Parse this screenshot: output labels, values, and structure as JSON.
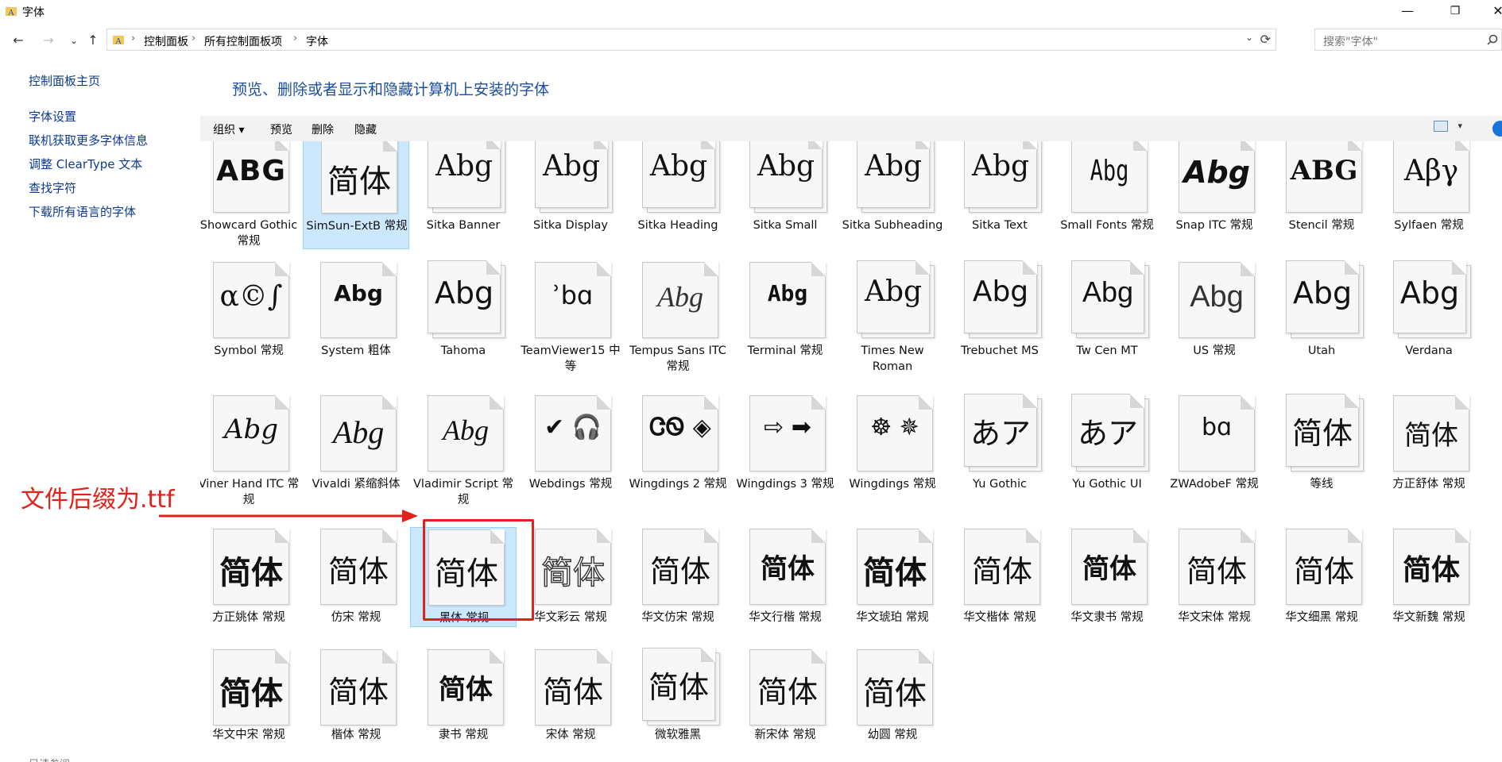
{
  "window": {
    "title": "字体",
    "minimize": "—",
    "restore": "❐",
    "close": "✕"
  },
  "nav": {
    "back": "←",
    "forward": "→",
    "dropdown": "⌄",
    "up": "↑"
  },
  "address": {
    "crumbs": [
      "控制面板",
      "所有控制面板项",
      "字体"
    ],
    "separator": "›",
    "dropdown": "⌄",
    "refresh": "⟳"
  },
  "search": {
    "placeholder": "搜索\"字体\""
  },
  "sidebar": {
    "home": "控制面板主页",
    "links": [
      "字体设置",
      "联机获取更多字体信息",
      "调整 ClearType 文本",
      "查找字符",
      "下载所有语言的字体"
    ],
    "bottom": "另请参阅"
  },
  "heading": "预览、删除或者显示和隐藏计算机上安装的字体",
  "toolbar": {
    "organize": "组织 ▾",
    "preview": "预览",
    "delete": "删除",
    "hide": "隐藏",
    "view_drop": "▾"
  },
  "fonts": [
    {
      "sample": "ABG",
      "label": "Showcard Gothic 常规",
      "stack": false,
      "sel": false
    },
    {
      "sample": "简体",
      "label": "SimSun-ExtB 常规",
      "stack": false,
      "sel": true
    },
    {
      "sample": "Abg",
      "label": "Sitka Banner",
      "stack": true,
      "sel": false
    },
    {
      "sample": "Abg",
      "label": "Sitka Display",
      "stack": true,
      "sel": false
    },
    {
      "sample": "Abg",
      "label": "Sitka Heading",
      "stack": true,
      "sel": false
    },
    {
      "sample": "Abg",
      "label": "Sitka Small",
      "stack": true,
      "sel": false
    },
    {
      "sample": "Abg",
      "label": "Sitka Subheading",
      "stack": true,
      "sel": false
    },
    {
      "sample": "Abg",
      "label": "Sitka Text",
      "stack": true,
      "sel": false
    },
    {
      "sample": "Abg",
      "label": "Small Fonts 常规",
      "stack": false,
      "sel": false
    },
    {
      "sample": "Abg",
      "label": "Snap ITC 常规",
      "stack": false,
      "sel": false
    },
    {
      "sample": "ABG",
      "label": "Stencil 常规",
      "stack": false,
      "sel": false
    },
    {
      "sample": "Αβγ",
      "label": "Sylfaen 常规",
      "stack": false,
      "sel": false
    },
    {
      "sample": "α©∫",
      "label": "Symbol 常规",
      "stack": false,
      "sel": false
    },
    {
      "sample": "Abg",
      "label": "System 粗体",
      "stack": false,
      "sel": false
    },
    {
      "sample": "Abg",
      "label": "Tahoma",
      "stack": true,
      "sel": false
    },
    {
      "sample": "ʾbɑ",
      "label": "TeamViewer15 中等",
      "stack": false,
      "sel": false
    },
    {
      "sample": "Abg",
      "label": "Tempus Sans ITC 常规",
      "stack": false,
      "sel": false
    },
    {
      "sample": "Abg",
      "label": "Terminal 常规",
      "stack": false,
      "sel": false
    },
    {
      "sample": "Abg",
      "label": "Times New Roman",
      "stack": true,
      "sel": false
    },
    {
      "sample": "Abg",
      "label": "Trebuchet MS",
      "stack": true,
      "sel": false
    },
    {
      "sample": "Abg",
      "label": "Tw Cen MT",
      "stack": true,
      "sel": false
    },
    {
      "sample": "Abg",
      "label": "US 常规",
      "stack": false,
      "sel": false
    },
    {
      "sample": "Abg",
      "label": "Utah",
      "stack": true,
      "sel": false
    },
    {
      "sample": "Abg",
      "label": "Verdana",
      "stack": true,
      "sel": false
    },
    {
      "sample": "Abg",
      "label": "Viner Hand ITC 常规",
      "stack": false,
      "sel": false
    },
    {
      "sample": "Abg",
      "label": "Vivaldi 紧缩斜体",
      "stack": false,
      "sel": false
    },
    {
      "sample": "Abg",
      "label": "Vladimir Script 常规",
      "stack": false,
      "sel": false
    },
    {
      "sample": "✔ 🎧",
      "label": "Webdings 常规",
      "stack": false,
      "sel": false
    },
    {
      "sample": "ᏣᏫ ◈",
      "label": "Wingdings 2 常规",
      "stack": false,
      "sel": false
    },
    {
      "sample": "⇨ ➡",
      "label": "Wingdings 3 常规",
      "stack": false,
      "sel": false
    },
    {
      "sample": "☸ ✵",
      "label": "Wingdings 常规",
      "stack": false,
      "sel": false
    },
    {
      "sample": "あア",
      "label": "Yu Gothic",
      "stack": true,
      "sel": false
    },
    {
      "sample": "あア",
      "label": "Yu Gothic UI",
      "stack": true,
      "sel": false
    },
    {
      "sample": "bɑ",
      "label": "ZWAdobeF 常规",
      "stack": false,
      "sel": false
    },
    {
      "sample": "简体",
      "label": "等线",
      "stack": true,
      "sel": false
    },
    {
      "sample": "简体",
      "label": "方正舒体 常规",
      "stack": false,
      "sel": false
    },
    {
      "sample": "简体",
      "label": "方正姚体 常规",
      "stack": false,
      "sel": false
    },
    {
      "sample": "简体",
      "label": "仿宋 常规",
      "stack": false,
      "sel": false
    },
    {
      "sample": "简体",
      "label": "黑体 常规",
      "stack": false,
      "sel": true
    },
    {
      "sample": "简体",
      "label": "华文彩云 常规",
      "stack": false,
      "sel": false
    },
    {
      "sample": "简体",
      "label": "华文仿宋 常规",
      "stack": false,
      "sel": false
    },
    {
      "sample": "简体",
      "label": "华文行楷 常规",
      "stack": false,
      "sel": false
    },
    {
      "sample": "简体",
      "label": "华文琥珀 常规",
      "stack": false,
      "sel": false
    },
    {
      "sample": "简体",
      "label": "华文楷体 常规",
      "stack": false,
      "sel": false
    },
    {
      "sample": "简体",
      "label": "华文隶书 常规",
      "stack": false,
      "sel": false
    },
    {
      "sample": "简体",
      "label": "华文宋体 常规",
      "stack": false,
      "sel": false
    },
    {
      "sample": "简体",
      "label": "华文细黑 常规",
      "stack": false,
      "sel": false
    },
    {
      "sample": "简体",
      "label": "华文新魏 常规",
      "stack": false,
      "sel": false
    },
    {
      "sample": "简体",
      "label": "华文中宋 常规",
      "stack": false,
      "sel": false
    },
    {
      "sample": "简体",
      "label": "楷体 常规",
      "stack": false,
      "sel": false
    },
    {
      "sample": "简体",
      "label": "隶书 常规",
      "stack": false,
      "sel": false
    },
    {
      "sample": "简体",
      "label": "宋体 常规",
      "stack": false,
      "sel": false
    },
    {
      "sample": "简体",
      "label": "微软雅黑",
      "stack": true,
      "sel": false
    },
    {
      "sample": "简体",
      "label": "新宋体 常规",
      "stack": false,
      "sel": false
    },
    {
      "sample": "简体",
      "label": "幼圆 常规",
      "stack": false,
      "sel": false
    }
  ],
  "annotation": {
    "text": "文件后缀为.ttf",
    "color": "#e0221b"
  },
  "colors": {
    "link": "#0b3a8f",
    "heading": "#1b4ea3",
    "selection": "#cce8ff",
    "annotation": "#e0221b"
  }
}
